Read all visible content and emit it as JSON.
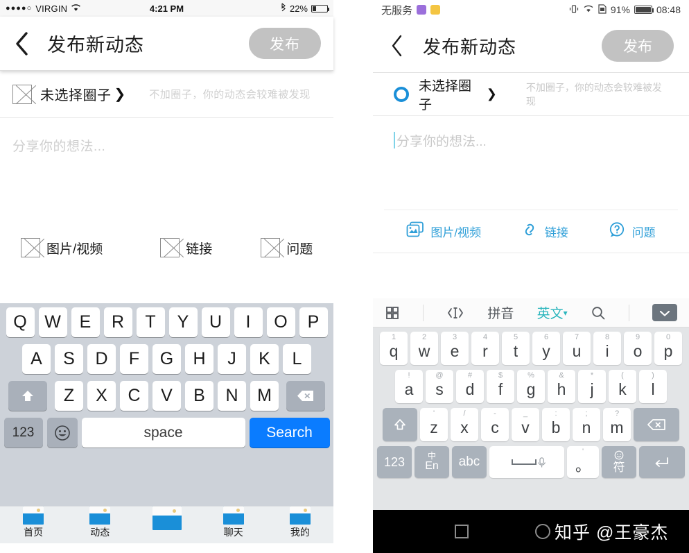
{
  "ios": {
    "statusbar": {
      "signal_dots": "●●●●○",
      "carrier": "VIRGIN",
      "wifi_icon": "wifi-icon",
      "time": "4:21 PM",
      "bluetooth_icon": "bluetooth-icon",
      "battery_percent": "22%",
      "battery_level": 22
    },
    "navbar": {
      "back_icon": "chevron-left-icon",
      "title": "发布新动态",
      "publish_label": "发布"
    },
    "circle_row": {
      "icon": "broken-image-icon",
      "label": "未选择圈子",
      "chevron": "❯",
      "hint": "不加圈子，你的动态会较难被发现"
    },
    "compose": {
      "placeholder": "分享你的想法...",
      "value": ""
    },
    "attachments": [
      {
        "icon": "broken-image-icon",
        "label": "图片/视频"
      },
      {
        "icon": "broken-image-icon",
        "label": "链接"
      },
      {
        "icon": "broken-image-icon",
        "label": "问题"
      }
    ],
    "keyboard": {
      "row1": [
        "Q",
        "W",
        "E",
        "R",
        "T",
        "Y",
        "U",
        "I",
        "O",
        "P"
      ],
      "row2": [
        "A",
        "S",
        "D",
        "F",
        "G",
        "H",
        "J",
        "K",
        "L"
      ],
      "row3": [
        "Z",
        "X",
        "C",
        "V",
        "B",
        "N",
        "M"
      ],
      "shift_icon": "shift-up-icon",
      "delete_icon": "backspace-icon",
      "numbers_label": "123",
      "emoji_icon": "smiley-icon",
      "space_label": "space",
      "search_label": "Search",
      "search_color": "#0a7cff"
    },
    "tabbar": [
      {
        "icon": "broken-image-icon",
        "label": "首页"
      },
      {
        "icon": "broken-image-icon",
        "label": "动态"
      },
      {
        "icon": "broken-image-icon",
        "label": ""
      },
      {
        "icon": "broken-image-icon",
        "label": "聊天"
      },
      {
        "icon": "broken-image-icon",
        "label": "我的"
      }
    ]
  },
  "android": {
    "statusbar": {
      "carrier": "无服务",
      "chip1": "app-badge-purple",
      "chip2": "app-badge-yellow",
      "vibrate_icon": "vibrate-icon",
      "wifi_icon": "wifi-icon",
      "sim_icon": "sim-card-icon",
      "battery_percent": "91%",
      "battery_level": 91,
      "time": "08:48"
    },
    "navbar": {
      "back_icon": "chevron-left-icon",
      "title": "发布新动态",
      "publish_label": "发布"
    },
    "circle_row": {
      "icon": "circle-ring-icon",
      "icon_color": "#1a8fd8",
      "label": "未选择圈子",
      "chevron": "❯",
      "hint": "不加圈子，你的动态会较难被发现"
    },
    "compose": {
      "placeholder": "分享你的想法...",
      "value": "",
      "caret_color": "#7fd3e8"
    },
    "attachments": [
      {
        "icon": "photo-video-icon",
        "label": "图片/视频"
      },
      {
        "icon": "link-icon",
        "label": "链接"
      },
      {
        "icon": "question-icon",
        "label": "问题"
      }
    ],
    "keyboard": {
      "toolbar": {
        "grid_icon": "grid-icon",
        "cursor_icon": "cursor-move-icon",
        "pinyin_label": "拼音",
        "english_label": "英文",
        "english_caret": "▾",
        "english_color": "#2bb6bd",
        "search_icon": "search-icon",
        "collapse_icon": "collapse-keyboard-icon"
      },
      "row1": [
        {
          "sup": "1",
          "main": "q"
        },
        {
          "sup": "2",
          "main": "w"
        },
        {
          "sup": "3",
          "main": "e"
        },
        {
          "sup": "4",
          "main": "r"
        },
        {
          "sup": "5",
          "main": "t"
        },
        {
          "sup": "6",
          "main": "y"
        },
        {
          "sup": "7",
          "main": "u"
        },
        {
          "sup": "8",
          "main": "i"
        },
        {
          "sup": "9",
          "main": "o"
        },
        {
          "sup": "0",
          "main": "p"
        }
      ],
      "row2": [
        {
          "sup": "!",
          "main": "a"
        },
        {
          "sup": "@",
          "main": "s"
        },
        {
          "sup": "#",
          "main": "d"
        },
        {
          "sup": "$",
          "main": "f"
        },
        {
          "sup": "%",
          "main": "g"
        },
        {
          "sup": "&",
          "main": "h"
        },
        {
          "sup": "*",
          "main": "j"
        },
        {
          "sup": "(",
          "main": "k"
        },
        {
          "sup": ")",
          "main": "l"
        }
      ],
      "row3": [
        {
          "sup": "'",
          "main": "z"
        },
        {
          "sup": "/",
          "main": "x"
        },
        {
          "sup": "-",
          "main": "c"
        },
        {
          "sup": "_",
          "main": "v"
        },
        {
          "sup": ":",
          "main": "b"
        },
        {
          "sup": ";",
          "main": "n"
        },
        {
          "sup": "?",
          "main": "m"
        }
      ],
      "shift_icon": "shift-up-icon",
      "delete_icon": "backspace-icon",
      "numbers_label": "123",
      "lang_top": "中",
      "lang_bottom": "En",
      "abc_label": "abc",
      "space_icon": "space-bar-icon",
      "mic_icon": "microphone-icon",
      "dot_sup": "'",
      "dot_main": "。",
      "symbol_top": "smiley-icon",
      "symbol_label": "符",
      "enter_icon": "enter-icon"
    },
    "navbuttons": {
      "recents_icon": "square-recents-icon",
      "home_icon": "circle-home-icon",
      "watermark": "知乎 @王豪杰"
    }
  }
}
